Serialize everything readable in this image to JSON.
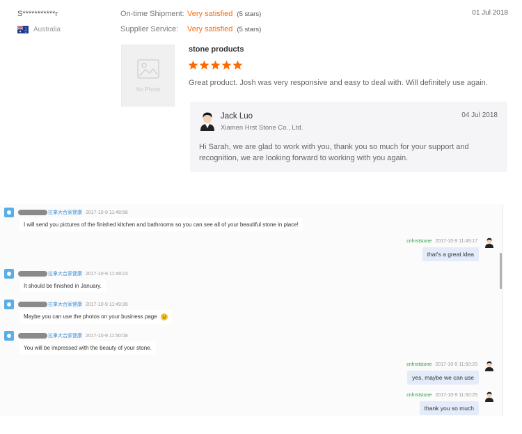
{
  "review": {
    "buyer_name": "S***********r",
    "country": "Australia",
    "ratings": [
      {
        "label": "On-time Shipment:",
        "value": "Very satisfied",
        "stars_text": "(5 stars)"
      },
      {
        "label": "Supplier Service:",
        "value": "Very satisfied",
        "stars_text": "(5 stars)"
      }
    ],
    "date": "01 Jul 2018",
    "no_photo_text": "No Photo",
    "product_name": "stone products",
    "star_rating": 5,
    "star_color": "#ff6a00",
    "text": "Great product. Josh was very responsive and easy to deal with. Will definitely use again.",
    "reply": {
      "name": "Jack Luo",
      "company": "Xiamen Hrst Stone Co., Ltd.",
      "date": "04 Jul 2018",
      "text": "Hi Sarah, we are glad to work with you, thank you so much for your support and recognition, we are looking forward to working with you again."
    }
  },
  "chat": {
    "incoming_tag": "拉拿大合家健康",
    "outgoing_name": "cnhrststone",
    "messages": [
      {
        "dir": "in",
        "time": "2017-10-9 11:48:58",
        "text": "I will send you pictures of the finished kitchen and bathrooms so you can see all of your beautiful stone in place!"
      },
      {
        "dir": "out",
        "time": "2017-10-9 11:49:17",
        "text": "that's a great idea"
      },
      {
        "dir": "in",
        "time": "2017-10-9 11:49:23",
        "text": "It should be finished in January."
      },
      {
        "dir": "in",
        "time": "2017-10-9 11:49:39",
        "text": "Maybe you can use the photos on your business page"
      },
      {
        "dir": "in",
        "time": "2017-10-9 11:50:08",
        "text": "You will be impressed with the beauty of your stone."
      },
      {
        "dir": "out",
        "time": "2017-10-9 11:50:20",
        "text": "yes, maybe we can use"
      },
      {
        "dir": "out",
        "time": "2017-10-9 11:50:25",
        "text": "thank you so much"
      }
    ]
  },
  "colors": {
    "accent": "#ff6a00",
    "chat_sender": "#3b8ed4",
    "chat_own": "#2e9b42",
    "own_bubble": "#e3ecf8"
  }
}
